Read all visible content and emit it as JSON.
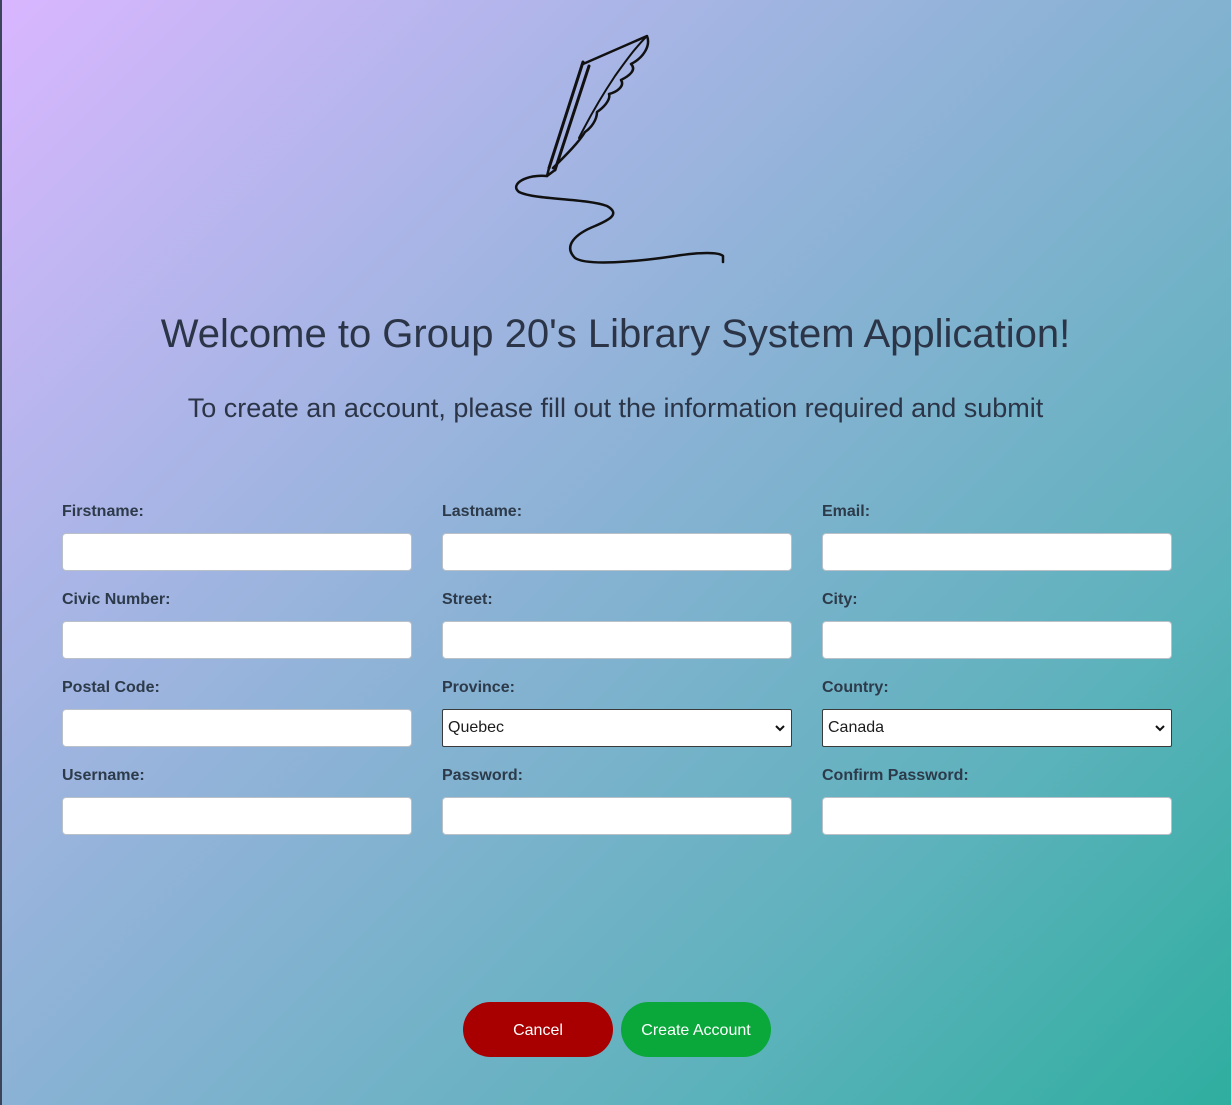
{
  "header": {
    "title": "Welcome to Group 20's Library System Application!",
    "subtitle": "To create an account, please fill out the information required and submit",
    "logo_icon": "quill-pen-signature-icon"
  },
  "form": {
    "firstname": {
      "label": "Firstname:",
      "value": ""
    },
    "lastname": {
      "label": "Lastname:",
      "value": ""
    },
    "email": {
      "label": "Email:",
      "value": ""
    },
    "civic_number": {
      "label": "Civic Number:",
      "value": ""
    },
    "street": {
      "label": "Street:",
      "value": ""
    },
    "city": {
      "label": "City:",
      "value": ""
    },
    "postal_code": {
      "label": "Postal Code:",
      "value": ""
    },
    "province": {
      "label": "Province:",
      "selected": "Quebec"
    },
    "country": {
      "label": "Country:",
      "selected": "Canada"
    },
    "username": {
      "label": "Username:",
      "value": ""
    },
    "password": {
      "label": "Password:",
      "value": ""
    },
    "confirm_password": {
      "label": "Confirm Password:",
      "value": ""
    }
  },
  "actions": {
    "cancel_label": "Cancel",
    "create_label": "Create Account"
  },
  "colors": {
    "cancel": "#a80000",
    "create": "#0aa83a",
    "text": "#2b3547"
  }
}
